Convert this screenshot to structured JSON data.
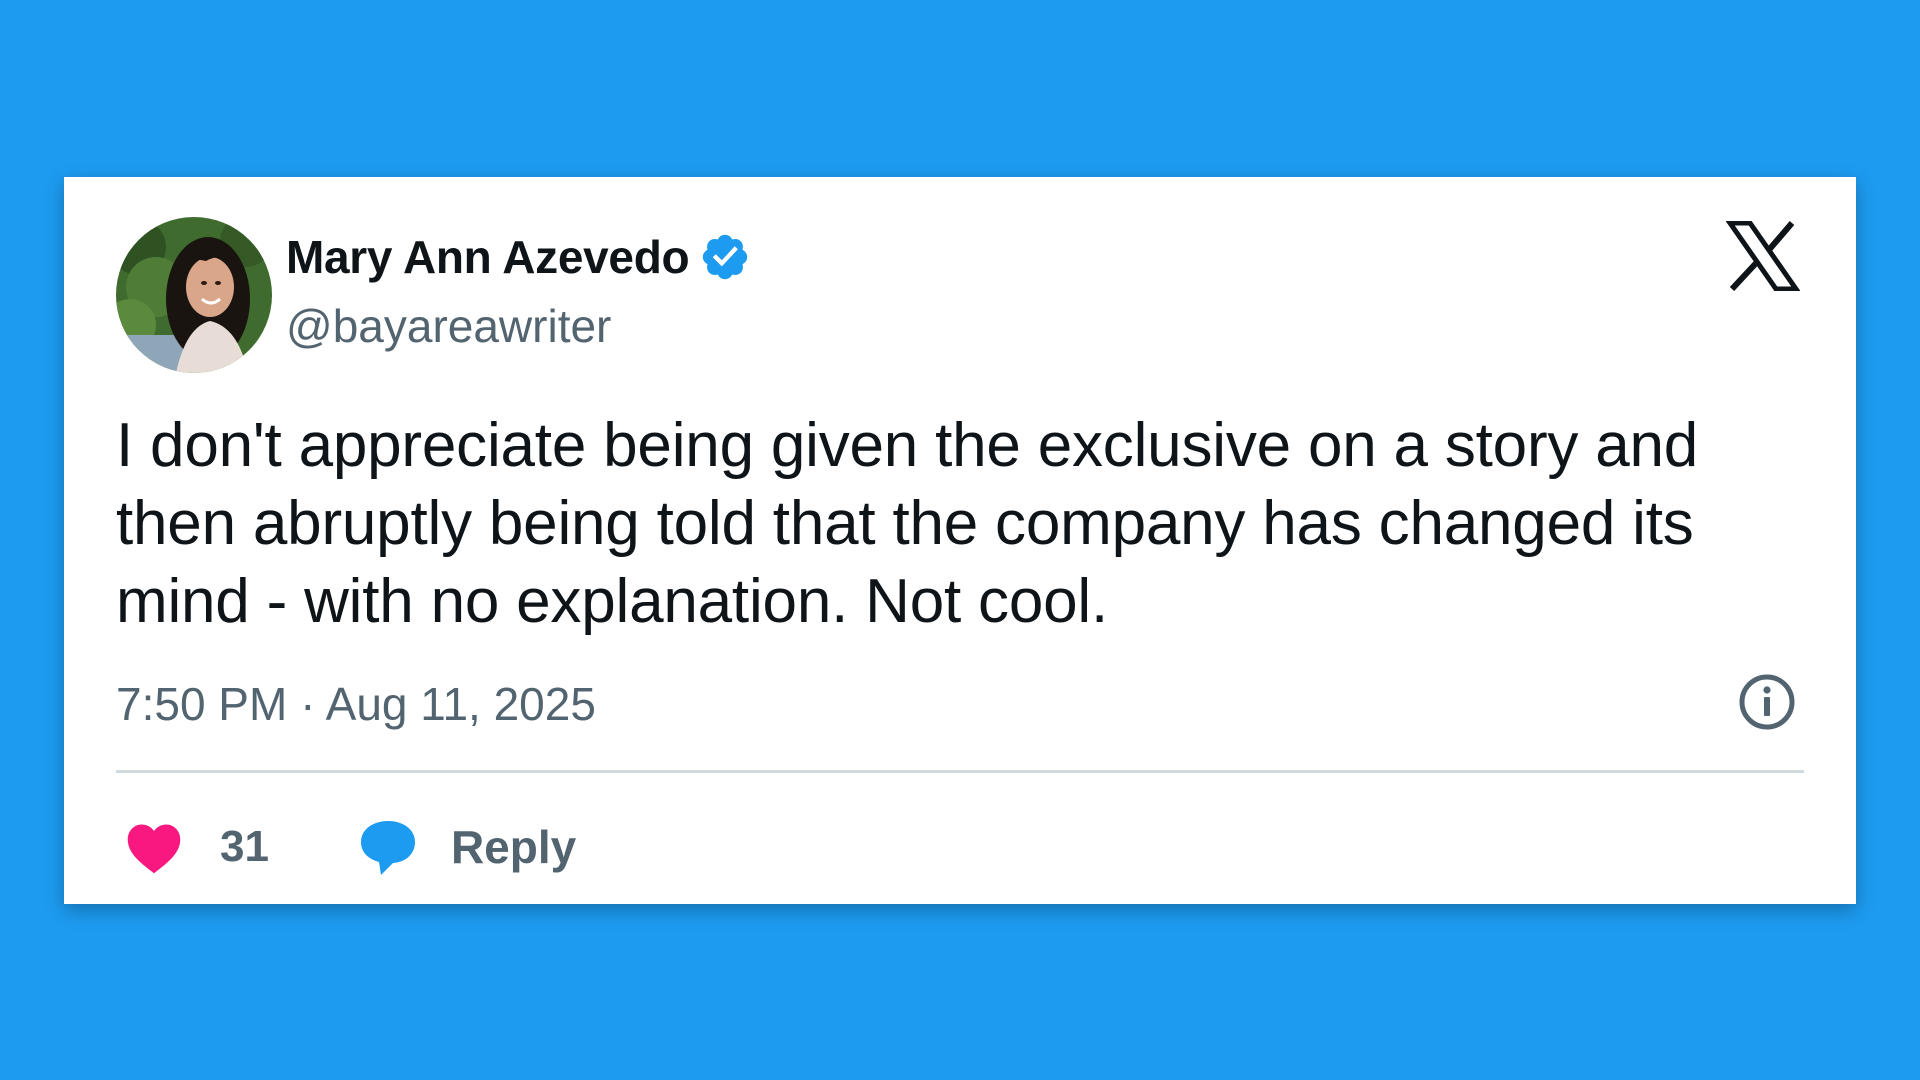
{
  "author": {
    "display_name": "Mary Ann Azevedo",
    "handle": "@bayareawriter",
    "verified": true,
    "avatar_icon": "user-avatar-photo",
    "verified_icon": "verified-badge-icon"
  },
  "brand": {
    "logo_icon": "x-logo-icon"
  },
  "tweet": {
    "text": "I don't appreciate being given the exclusive on a story and then abruptly being told that the company has changed its mind - with no explanation. Not cool.",
    "timestamp": "7:50 PM · Aug 11, 2025",
    "info_icon": "info-icon"
  },
  "actions": {
    "like_count": "31",
    "like_icon": "heart-icon",
    "reply_label": "Reply",
    "reply_icon": "speech-bubble-icon"
  },
  "colors": {
    "background": "#1d9bf0",
    "card": "#ffffff",
    "text_primary": "#0f1419",
    "text_secondary": "#536471",
    "like": "#f91880",
    "verified": "#1d9bf0"
  }
}
